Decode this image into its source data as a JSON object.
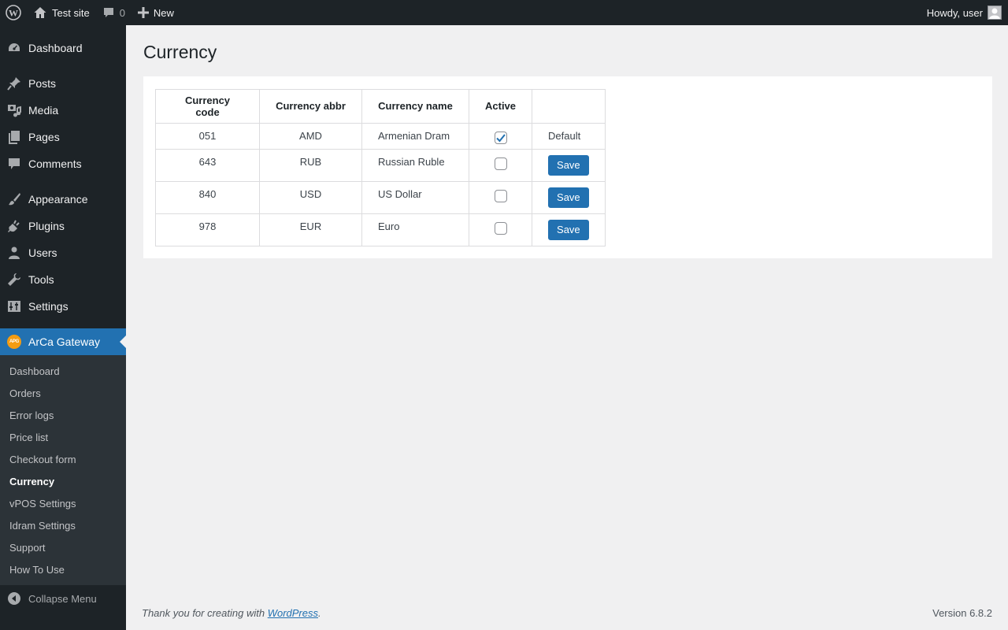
{
  "adminbar": {
    "site_name": "Test site",
    "comments_count": "0",
    "new_label": "New",
    "howdy": "Howdy, user"
  },
  "sidebar": {
    "items": [
      {
        "label": "Dashboard",
        "icon": "dashboard-icon"
      },
      {
        "label": "Posts",
        "icon": "pin-icon"
      },
      {
        "label": "Media",
        "icon": "media-icon"
      },
      {
        "label": "Pages",
        "icon": "pages-icon"
      },
      {
        "label": "Comments",
        "icon": "comment-icon"
      },
      {
        "label": "Appearance",
        "icon": "brush-icon"
      },
      {
        "label": "Plugins",
        "icon": "plugin-icon"
      },
      {
        "label": "Users",
        "icon": "user-icon"
      },
      {
        "label": "Tools",
        "icon": "wrench-icon"
      },
      {
        "label": "Settings",
        "icon": "settings-icon"
      },
      {
        "label": "ArCa Gateway",
        "icon": "arca-logo-icon",
        "logo_text": "APG"
      }
    ],
    "submenu": [
      "Dashboard",
      "Orders",
      "Error logs",
      "Price list",
      "Checkout form",
      "Currency",
      "vPOS Settings",
      "Idram Settings",
      "Support",
      "How To Use"
    ],
    "collapse_label": "Collapse Menu"
  },
  "page": {
    "title": "Currency"
  },
  "table": {
    "headers": [
      "Currency code",
      "Currency abbr",
      "Currency name",
      "Active",
      ""
    ],
    "rows": [
      {
        "code": "051",
        "abbr": "AMD",
        "name": "Armenian Dram",
        "active": true,
        "action": "Default"
      },
      {
        "code": "643",
        "abbr": "RUB",
        "name": "Russian Ruble",
        "active": false,
        "action": "Save"
      },
      {
        "code": "840",
        "abbr": "USD",
        "name": "US Dollar",
        "active": false,
        "action": "Save"
      },
      {
        "code": "978",
        "abbr": "EUR",
        "name": "Euro",
        "active": false,
        "action": "Save"
      }
    ]
  },
  "footer": {
    "thanks_prefix": "Thank you for creating with ",
    "link": "WordPress",
    "suffix": ".",
    "version": "Version 6.8.2"
  },
  "colors": {
    "accent": "#2271b1",
    "sidebar_bg": "#1d2327",
    "submenu_bg": "#2c3338",
    "arca_orange": "#f39c12"
  }
}
